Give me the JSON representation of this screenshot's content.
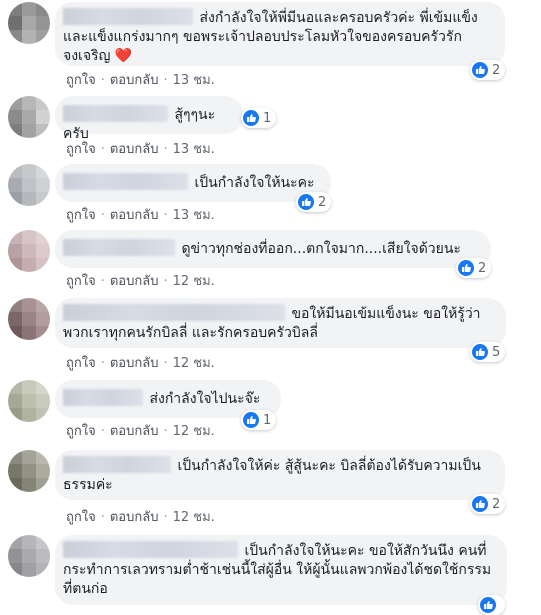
{
  "labels": {
    "like": "ถูกใจ",
    "reply": "ตอบกลับ",
    "dot": "·"
  },
  "comments": [
    {
      "text": "ส่งกำลังใจให้พี่มีนอและครอบครัวค่ะ พี่เข้มแข็งและแข็งแกร่งมากๆ ขอพระเจ้าปลอบประโลมหัวใจของครอบครัวรักจงเจริญ ❤️",
      "reactions": "2",
      "time": "13 ชม."
    },
    {
      "text": "สู้ๆๆนะครับ",
      "reactions": "1",
      "time": "13 ชม."
    },
    {
      "text": "เป็นกำลังใจให้นะคะ",
      "reactions": "2",
      "time": "13 ชม."
    },
    {
      "text": "ดูข่าวทุกช่องที่ออก...ตกใจมาก....เสียใจด้วยนะ",
      "reactions": "2",
      "time": "12 ชม."
    },
    {
      "text": "ขอให้มีนอเข้มแข็งนะ ขอให้รู้ว่าพวกเราทุกคนรักบิลลี่ และรักครอบครัวบิลลี่",
      "reactions": "5",
      "time": "12 ชม."
    },
    {
      "text": "ส่งกำลังใจไปนะจ๊ะ",
      "reactions": "1",
      "time": "12 ชม."
    },
    {
      "text": "เป็นกำลังใจให้ค่ะ สู้สู้นะคะ บิลลี่ต้องได้รับความเป็นธรรมค่ะ",
      "reactions": "2",
      "time": "12 ชม."
    },
    {
      "text": "เป็นกำลังใจให้นะคะ ขอให้สักวันนึง คนที่กระทำการเลวทรามต่ำช้าเช่นนี้ใส่ผู้อื่น ให้ผู้นั้นแลพวกพ้องได้ชดใช้กรรมที่ตนก่อ",
      "reactions": "",
      "time": ""
    }
  ]
}
